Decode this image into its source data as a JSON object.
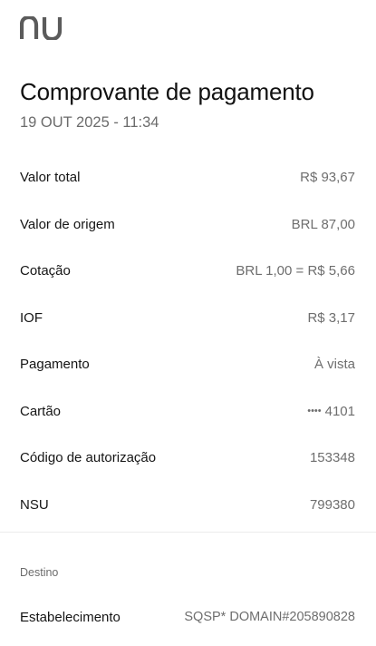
{
  "app": {
    "logo_text": "nu",
    "logo_color": "#5b5b5b"
  },
  "header": {
    "title": "Comprovante de pagamento",
    "datetime": "19 OUT 2025 - 11:34"
  },
  "details": {
    "rows": [
      {
        "label": "Valor total",
        "value": "R$ 93,67"
      },
      {
        "label": "Valor de origem",
        "value": "BRL 87,00"
      },
      {
        "label": "Cotação",
        "value": "BRL 1,00 = R$ 5,66"
      },
      {
        "label": "IOF",
        "value": "R$ 3,17"
      },
      {
        "label": "Pagamento",
        "value": "À vista"
      },
      {
        "label": "Cartão",
        "masked_prefix": "••••",
        "value": "4101"
      },
      {
        "label": "Código de autorização",
        "value": "153348"
      },
      {
        "label": "NSU",
        "value": "799380"
      }
    ]
  },
  "destination": {
    "section_title": "Destino",
    "establishment_label": "Estabelecimento",
    "establishment_value": "SQSP* DOMAIN#205890828"
  },
  "colors": {
    "text_primary": "#151515",
    "text_secondary": "#6e6e6e",
    "divider": "#ececec",
    "background": "#ffffff"
  }
}
